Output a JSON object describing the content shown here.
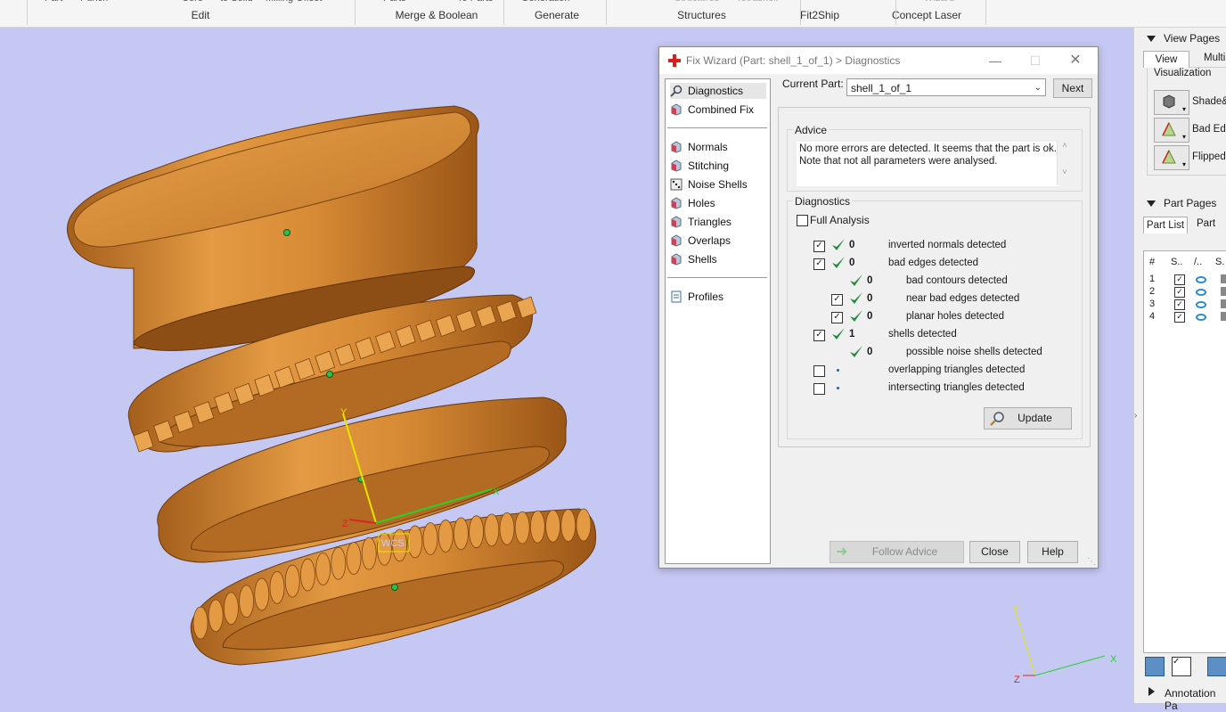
{
  "ribbon": {
    "cut_labels": [
      "Part",
      "Punch",
      "Core",
      "to Solid",
      "Milling Offset",
      "Parts",
      "To Parts",
      "Generation",
      "Structures",
      "Tetrashell",
      "Wizard"
    ],
    "groups": [
      "Edit",
      "Merge & Boolean",
      "Generate",
      "Structures",
      "Fit2Ship",
      "Concept Laser"
    ]
  },
  "viewport": {
    "axes_small": {
      "x": "X",
      "y": "Y",
      "z": "Z"
    },
    "corner_axes": {
      "x": "X",
      "y": "Y",
      "z": "Z"
    },
    "origin_label": "WCS",
    "colors": {
      "background": "#c6c8f4",
      "part": "#d98a30",
      "x_axis": "#22cc22",
      "y_axis": "#e0e000",
      "z_axis": "#dd2222"
    }
  },
  "dialog": {
    "title": "Fix Wizard (Part: shell_1_of_1) > Diagnostics",
    "nav_group1": [
      {
        "label": "Diagnostics",
        "icon": "magnifier-icon",
        "selected": true
      },
      {
        "label": "Combined Fix",
        "icon": "cube-icon",
        "selected": false
      }
    ],
    "nav_group2": [
      {
        "label": "Normals",
        "icon": "cube-icon"
      },
      {
        "label": "Stitching",
        "icon": "cube-icon"
      },
      {
        "label": "Noise Shells",
        "icon": "dice-icon"
      },
      {
        "label": "Holes",
        "icon": "cube-icon"
      },
      {
        "label": "Triangles",
        "icon": "cube-icon"
      },
      {
        "label": "Overlaps",
        "icon": "cube-icon"
      },
      {
        "label": "Shells",
        "icon": "cube-icon"
      }
    ],
    "nav_group3": [
      {
        "label": "Profiles",
        "icon": "document-icon"
      }
    ],
    "current_part_label": "Current Part:",
    "current_part_value": "shell_1_of_1",
    "next_label": "Next",
    "advice_legend": "Advice",
    "advice_text_line1": "No more errors are detected. It seems that the part is ok.",
    "advice_text_line2": "Note that not all parameters were analysed.",
    "diagnostics_legend": "Diagnostics",
    "full_analysis_label": "Full Analysis",
    "full_analysis_checked": false,
    "diagnostics": [
      {
        "checkbox": true,
        "checked": true,
        "status": "ok",
        "count": "0",
        "label": "inverted normals detected",
        "indent": 0
      },
      {
        "checkbox": true,
        "checked": true,
        "status": "ok",
        "count": "0",
        "label": "bad edges detected",
        "indent": 0
      },
      {
        "checkbox": false,
        "checked": false,
        "status": "ok",
        "count": "0",
        "label": "bad contours detected",
        "indent": 1
      },
      {
        "checkbox": true,
        "checked": true,
        "status": "ok",
        "count": "0",
        "label": "near bad edges detected",
        "indent": 1
      },
      {
        "checkbox": true,
        "checked": true,
        "status": "ok",
        "count": "0",
        "label": "planar holes detected",
        "indent": 1
      },
      {
        "checkbox": true,
        "checked": true,
        "status": "ok",
        "count": "1",
        "label": "shells detected",
        "indent": 0
      },
      {
        "checkbox": false,
        "checked": false,
        "status": "ok",
        "count": "0",
        "label": "possible noise shells detected",
        "indent": 1
      },
      {
        "checkbox": true,
        "checked": false,
        "status": "pending",
        "count": "",
        "label": "overlapping triangles detected",
        "indent": 0
      },
      {
        "checkbox": true,
        "checked": false,
        "status": "pending",
        "count": "",
        "label": "intersecting triangles detected",
        "indent": 0
      }
    ],
    "update_label": "Update",
    "follow_advice_label": "Follow Advice",
    "close_label": "Close",
    "help_label": "Help"
  },
  "right_panel": {
    "view_pages_header": "View Pages",
    "view_tabs": [
      "View",
      "Multi"
    ],
    "visualization_legend": "Visualization",
    "visualization_items": [
      "Shade&",
      "Bad Edg",
      "Flipped"
    ],
    "part_pages_header": "Part Pages",
    "part_tabs": [
      "Part List",
      "Part"
    ],
    "part_list_headers": [
      "#",
      "S..",
      "/..",
      "S."
    ],
    "parts": [
      {
        "num": "1",
        "checked": true
      },
      {
        "num": "2",
        "checked": true
      },
      {
        "num": "3",
        "checked": true
      },
      {
        "num": "4",
        "checked": true
      }
    ],
    "annotation_header": "Annotation Pa"
  }
}
